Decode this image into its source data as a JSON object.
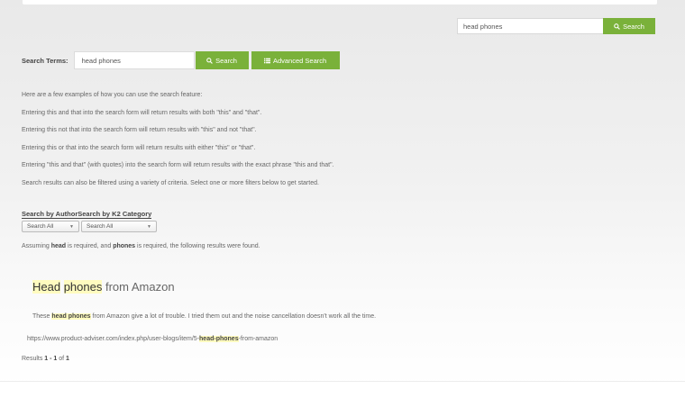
{
  "header_search": {
    "value": "head phones",
    "button_label": "Search",
    "button_icon": "search-icon"
  },
  "search_form": {
    "label": "Search Terms:",
    "value": "head phones",
    "search_button_label": "Search",
    "search_button_icon": "search-icon",
    "advanced_button_label": "Advanced Search",
    "advanced_button_icon": "list-icon"
  },
  "examples": [
    "Here are a few examples of how you can use the search feature:",
    "Entering this and that into the search form will return results with both \"this\" and \"that\".",
    "Entering this not that into the search form will return results with \"this\" and not \"that\".",
    "Entering this or that into the search form will return results with either \"this\" or \"that\".",
    "Entering \"this and that\" (with quotes) into the search form will return results with the exact phrase \"this and that\".",
    "Search results can also be filtered using a variety of criteria. Select one or more filters below to get started."
  ],
  "filters": {
    "title": "Search by AuthorSearch by K2 Category",
    "author_select": "Search All",
    "category_select": "Search All"
  },
  "assuming": {
    "prefix": "Assuming ",
    "term1": "head",
    "middle": " is required, and ",
    "term2": "phones",
    "suffix": " is required, the following results were found."
  },
  "result": {
    "title_hl1": "Head",
    "title_hl2": "phones",
    "title_rest": " from Amazon",
    "desc_prefix": "These ",
    "desc_hl": "head phones",
    "desc_rest": " from Amazon give a lot of trouble. I tried them out and the noise cancellation doesn't work all the time.",
    "url_prefix": "https://www.product-adviser.com/index.php/user-blogs/item/5-",
    "url_hl": "head-phones",
    "url_suffix": "-from-amazon"
  },
  "pagination": {
    "prefix": "Results ",
    "range": "1 - 1",
    "of": " of ",
    "total": "1"
  },
  "colors": {
    "accent": "#7ab13a",
    "highlight": "#fffbbf"
  }
}
